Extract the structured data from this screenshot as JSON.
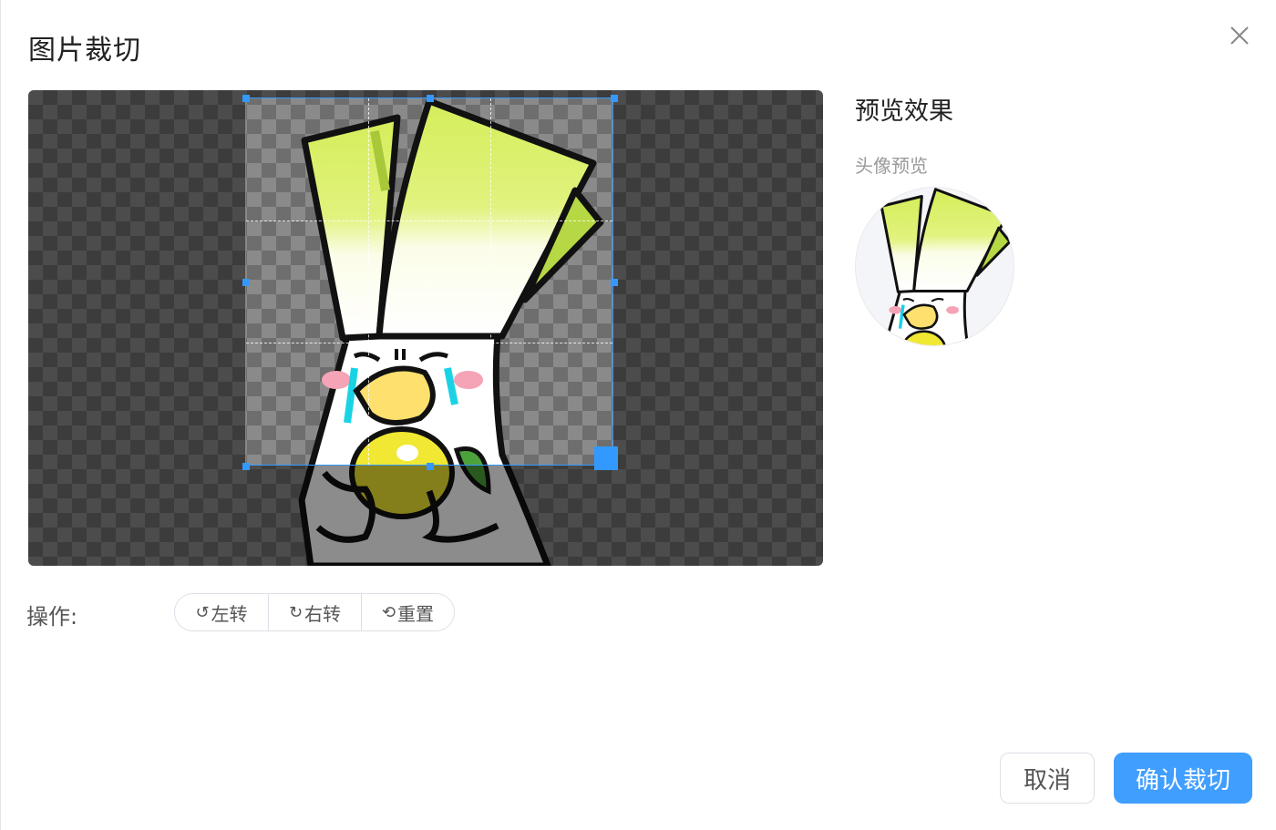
{
  "dialog": {
    "title": "图片裁切",
    "close_icon": "close-icon"
  },
  "cropper": {
    "image_icon": "leek-cartoon-image"
  },
  "preview": {
    "title": "预览效果",
    "avatar_label": "头像预览"
  },
  "operations": {
    "label": "操作:",
    "rotate_left": "左转",
    "rotate_right": "右转",
    "reset": "重置"
  },
  "footer": {
    "cancel": "取消",
    "confirm": "确认裁切"
  },
  "colors": {
    "accent": "#409eff",
    "crop_border": "#3399ff"
  }
}
